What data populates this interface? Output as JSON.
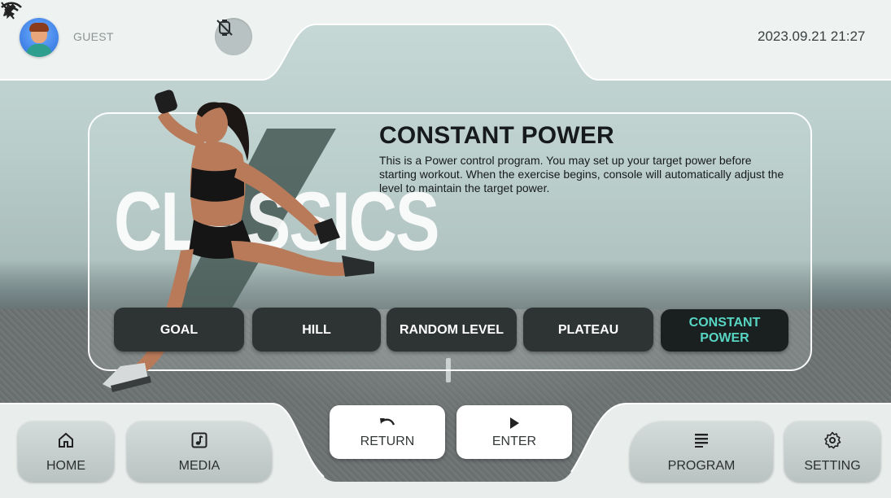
{
  "header": {
    "user_name": "GUEST",
    "datetime": "2023.09.21 21:27",
    "icons": [
      "avatar",
      "pencil-icon",
      "watch-off-icon",
      "bluetooth-off-icon",
      "wifi-icon"
    ]
  },
  "program": {
    "brand_text": "CLASSICS",
    "title": "CONSTANT POWER",
    "description": "This is a Power control program. You may set up your target power before starting workout. When the exercise begins, console will automatically adjust the level to maintain the target power."
  },
  "program_buttons": [
    {
      "label": "GOAL",
      "active": false
    },
    {
      "label": "HILL",
      "active": false
    },
    {
      "label": "RANDOM LEVEL",
      "active": false
    },
    {
      "label": "PLATEAU",
      "active": false
    },
    {
      "label": "CONSTANT POWER",
      "active": true
    }
  ],
  "bottom_nav": {
    "home": "HOME",
    "media": "MEDIA",
    "return": "RETURN",
    "enter": "ENTER",
    "program": "PROGRAM",
    "setting": "SETTING"
  },
  "colors": {
    "accent": "#58d6c4",
    "button_dark": "#2e3434",
    "bar_light": "#e9eeed"
  }
}
